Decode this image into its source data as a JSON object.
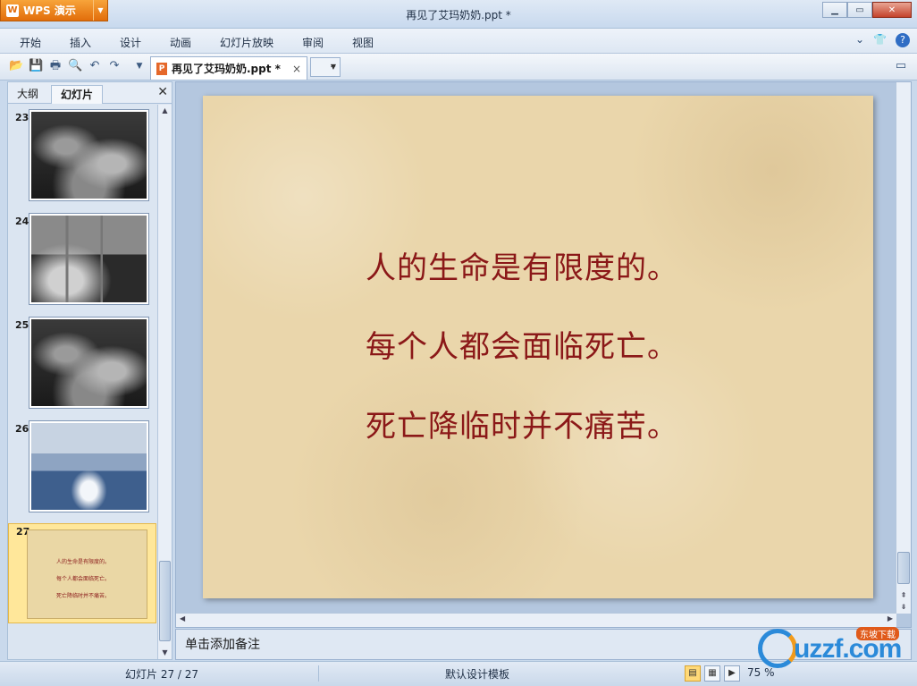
{
  "app": {
    "name": "WPS 演示",
    "title": "再见了艾玛奶奶.ppt *"
  },
  "menu": [
    "开始",
    "插入",
    "设计",
    "动画",
    "幻灯片放映",
    "审阅",
    "视图"
  ],
  "toolbar": {
    "doc_tab": "再见了艾玛奶奶.ppt *",
    "new_tab": "+"
  },
  "left_panel": {
    "tabs": [
      "大纲",
      "幻灯片"
    ],
    "active_tab": "幻灯片",
    "slides": [
      {
        "num": "23",
        "kind": "photo-bw"
      },
      {
        "num": "24",
        "kind": "photo-window"
      },
      {
        "num": "25",
        "kind": "photo-bw"
      },
      {
        "num": "26",
        "kind": "photo-blue"
      },
      {
        "num": "27",
        "kind": "text",
        "selected": true
      }
    ]
  },
  "slide": {
    "lines": [
      "人的生命是有限度的。",
      "每个人都会面临死亡。",
      "死亡降临时并不痛苦。"
    ],
    "text_color": "#8b1818",
    "background": "parchment"
  },
  "notes": {
    "placeholder": "单击添加备注"
  },
  "status": {
    "slide_counter": "幻灯片 27 / 27",
    "template": "默认设计模板",
    "zoom": "75 %"
  },
  "watermark": {
    "brand": "uzzf.com",
    "tag": "东坡下载"
  },
  "colors": {
    "app_button": "#e26d0b",
    "selected_thumb": "#ffe79a",
    "ribbon": "#dde7f3"
  }
}
